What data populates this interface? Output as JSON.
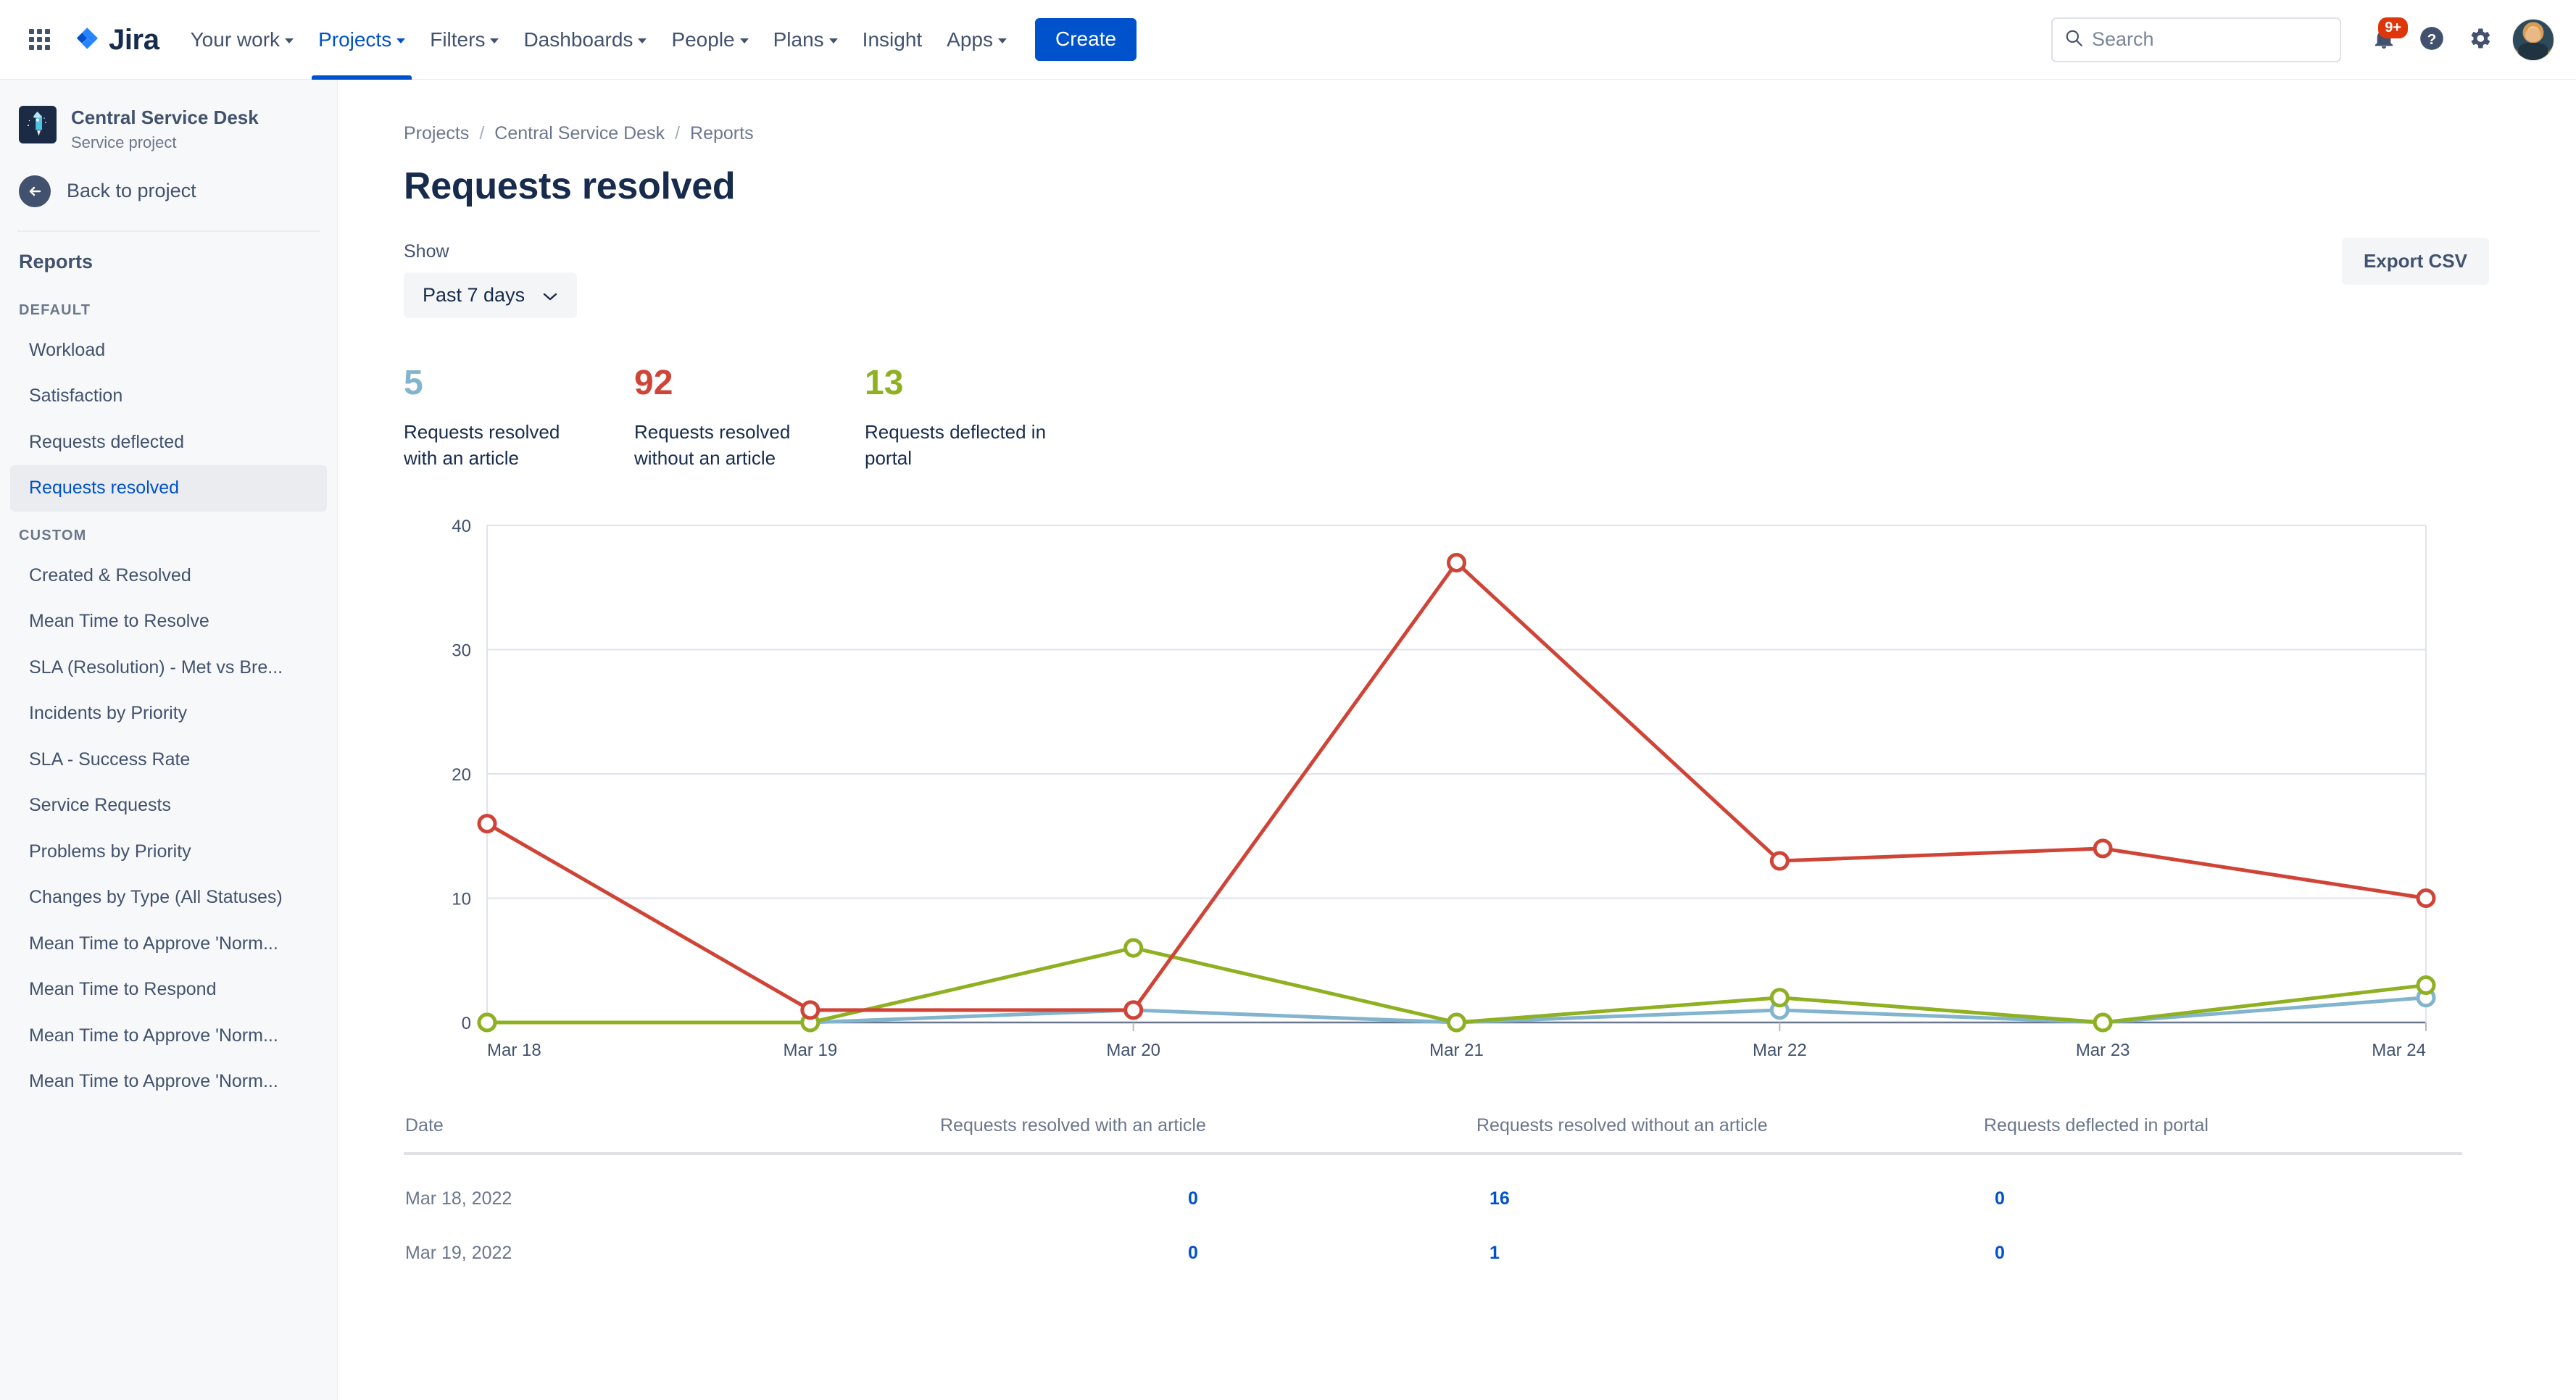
{
  "topnav": {
    "brand": "Jira",
    "items": [
      {
        "label": "Your work",
        "has_caret": true,
        "active": false
      },
      {
        "label": "Projects",
        "has_caret": true,
        "active": true
      },
      {
        "label": "Filters",
        "has_caret": true,
        "active": false
      },
      {
        "label": "Dashboards",
        "has_caret": true,
        "active": false
      },
      {
        "label": "People",
        "has_caret": true,
        "active": false
      },
      {
        "label": "Plans",
        "has_caret": true,
        "active": false
      },
      {
        "label": "Insight",
        "has_caret": false,
        "active": false
      },
      {
        "label": "Apps",
        "has_caret": true,
        "active": false
      }
    ],
    "create_label": "Create",
    "search_placeholder": "Search",
    "notification_badge": "9+",
    "accent_color": "#0052cc",
    "badge_color": "#de350b"
  },
  "sidebar": {
    "project_name": "Central Service Desk",
    "project_type": "Service project",
    "back_label": "Back to project",
    "section_title": "Reports",
    "groups": [
      {
        "title": "DEFAULT",
        "items": [
          {
            "label": "Workload",
            "selected": false
          },
          {
            "label": "Satisfaction",
            "selected": false
          },
          {
            "label": "Requests deflected",
            "selected": false
          },
          {
            "label": "Requests resolved",
            "selected": true
          }
        ]
      },
      {
        "title": "CUSTOM",
        "items": [
          {
            "label": "Created & Resolved",
            "selected": false
          },
          {
            "label": "Mean Time to Resolve",
            "selected": false
          },
          {
            "label": "SLA (Resolution) - Met vs Bre...",
            "selected": false
          },
          {
            "label": "Incidents by Priority",
            "selected": false
          },
          {
            "label": "SLA - Success Rate",
            "selected": false
          },
          {
            "label": "Service Requests",
            "selected": false
          },
          {
            "label": "Problems by Priority",
            "selected": false
          },
          {
            "label": "Changes by Type (All Statuses)",
            "selected": false
          },
          {
            "label": "Mean Time to Approve 'Norm...",
            "selected": false
          },
          {
            "label": "Mean Time to Respond",
            "selected": false
          },
          {
            "label": "Mean Time to Approve 'Norm...",
            "selected": false
          },
          {
            "label": "Mean Time to Approve 'Norm...",
            "selected": false
          }
        ]
      }
    ]
  },
  "breadcrumb": [
    "Projects",
    "Central Service Desk",
    "Reports"
  ],
  "page": {
    "title": "Requests resolved",
    "export_label": "Export CSV",
    "show_label": "Show",
    "range_value": "Past 7 days"
  },
  "stats": [
    {
      "value": "5",
      "label": "Requests resolved with an article",
      "color": "#82b5cd"
    },
    {
      "value": "92",
      "label": "Requests resolved without an article",
      "color": "#d04437"
    },
    {
      "value": "13",
      "label": "Requests deflected in portal",
      "color": "#8eb021"
    }
  ],
  "chart_data": {
    "type": "line",
    "title": "",
    "xlabel": "",
    "ylabel": "",
    "x": [
      "Mar 18",
      "Mar 19",
      "Mar 20",
      "Mar 21",
      "Mar 22",
      "Mar 23",
      "Mar 24"
    ],
    "yticks": [
      0,
      10,
      20,
      30,
      40
    ],
    "ylim": [
      0,
      40
    ],
    "grid": true,
    "legend": "none",
    "series": [
      {
        "name": "Requests resolved without an article",
        "color": "#d04437",
        "values": [
          16,
          1,
          1,
          37,
          13,
          14,
          10
        ]
      },
      {
        "name": "Requests deflected in portal",
        "color": "#8eb021",
        "values": [
          0,
          0,
          6,
          0,
          2,
          0,
          3
        ]
      },
      {
        "name": "Requests resolved with an article",
        "color": "#82b5cd",
        "values": [
          0,
          0,
          1,
          0,
          1,
          0,
          2
        ]
      }
    ]
  },
  "table": {
    "columns": [
      "Date",
      "Requests resolved with an article",
      "Requests resolved without an article",
      "Requests deflected in portal"
    ],
    "rows": [
      {
        "date": "Mar 18, 2022",
        "with_article": "0",
        "without_article": "16",
        "deflected": "0"
      },
      {
        "date": "Mar 19, 2022",
        "with_article": "0",
        "without_article": "1",
        "deflected": "0"
      }
    ]
  }
}
